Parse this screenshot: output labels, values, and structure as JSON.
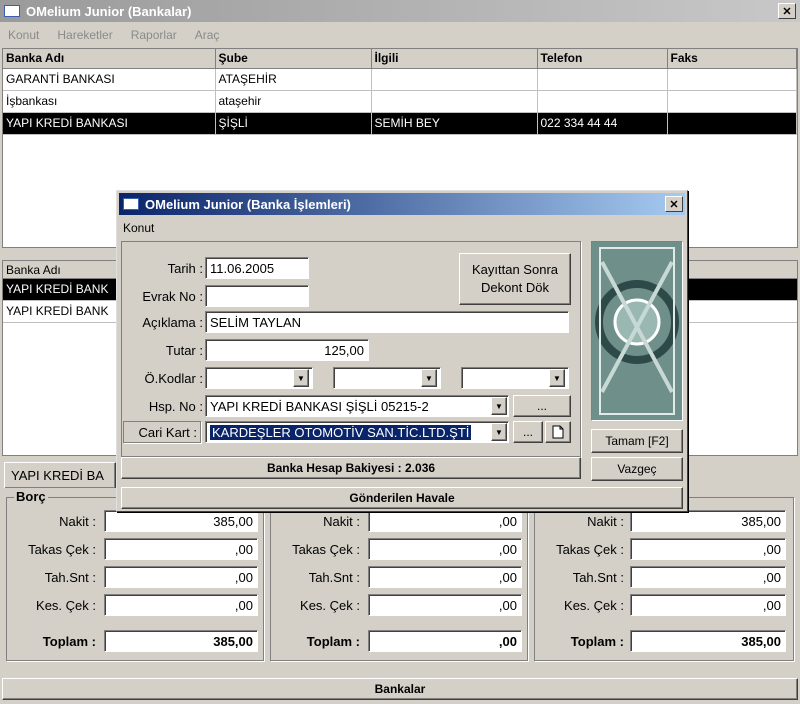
{
  "main": {
    "title": "OMelium Junior (Bankalar)",
    "menu": [
      "Konut",
      "Hareketler",
      "Raporlar",
      "Araç"
    ],
    "table": {
      "headers": [
        "Banka Adı",
        "Şube",
        "İlgili",
        "Telefon",
        "Faks"
      ],
      "rows": [
        [
          "GARANTİ BANKASI",
          "ATAŞEHİR",
          "",
          "",
          ""
        ],
        [
          "İşbankası",
          "ataşehir",
          "",
          "",
          ""
        ],
        [
          "YAPI KREDİ BANKASI",
          "ŞİŞLİ",
          "SEMİH BEY",
          "022 334 44 44",
          ""
        ]
      ]
    },
    "lower_table": {
      "header": "Banka Adı",
      "rows": [
        "YAPI KREDİ BANK",
        "YAPI KREDİ BANK"
      ]
    },
    "bank_tab": "YAPI KREDİ BA",
    "borc_label": "Borç",
    "groups": [
      {
        "nakit": "385,00",
        "takas_cek": ",00",
        "tah_snt": ",00",
        "kes_cek": ",00",
        "toplam": "385,00"
      },
      {
        "nakit": ",00",
        "takas_cek": ",00",
        "tah_snt": ",00",
        "kes_cek": ",00",
        "toplam": ",00"
      },
      {
        "nakit": "385,00",
        "takas_cek": ",00",
        "tah_snt": ",00",
        "kes_cek": ",00",
        "toplam": "385,00"
      }
    ],
    "labels": {
      "nakit": "Nakit :",
      "takas_cek": "Takas Çek :",
      "tah_snt": "Tah.Snt :",
      "kes_cek": "Kes. Çek :",
      "toplam": "Toplam :"
    },
    "status": "Bankalar"
  },
  "dialog": {
    "title": "OMelium Junior (Banka İşlemleri)",
    "menu": "Konut",
    "labels": {
      "tarih": "Tarih :",
      "evrak_no": "Evrak No :",
      "aciklama": "Açıklama :",
      "tutar": "Tutar :",
      "o_kodlar": "Ö.Kodlar :",
      "hsp_no": "Hsp. No :",
      "cari_kart": "Cari Kart :"
    },
    "values": {
      "tarih": "11.06.2005",
      "evrak_no": "",
      "aciklama": "SELİM TAYLAN",
      "tutar": "125,00",
      "hsp_no": "YAPI KREDİ BANKASI ŞİŞLİ 05215-2",
      "cari_kart": "KARDEŞLER OTOMOTİV SAN.TİC.LTD.ŞTİ"
    },
    "kayit_button": "Kayıttan Sonra Dekont Dök",
    "ellipsis": "...",
    "tamam": "Tamam [F2]",
    "vazgec": "Vazgeç",
    "bakiye": "Banka Hesap Bakiyesi : 2.036",
    "status": "Gönderilen Havale"
  }
}
